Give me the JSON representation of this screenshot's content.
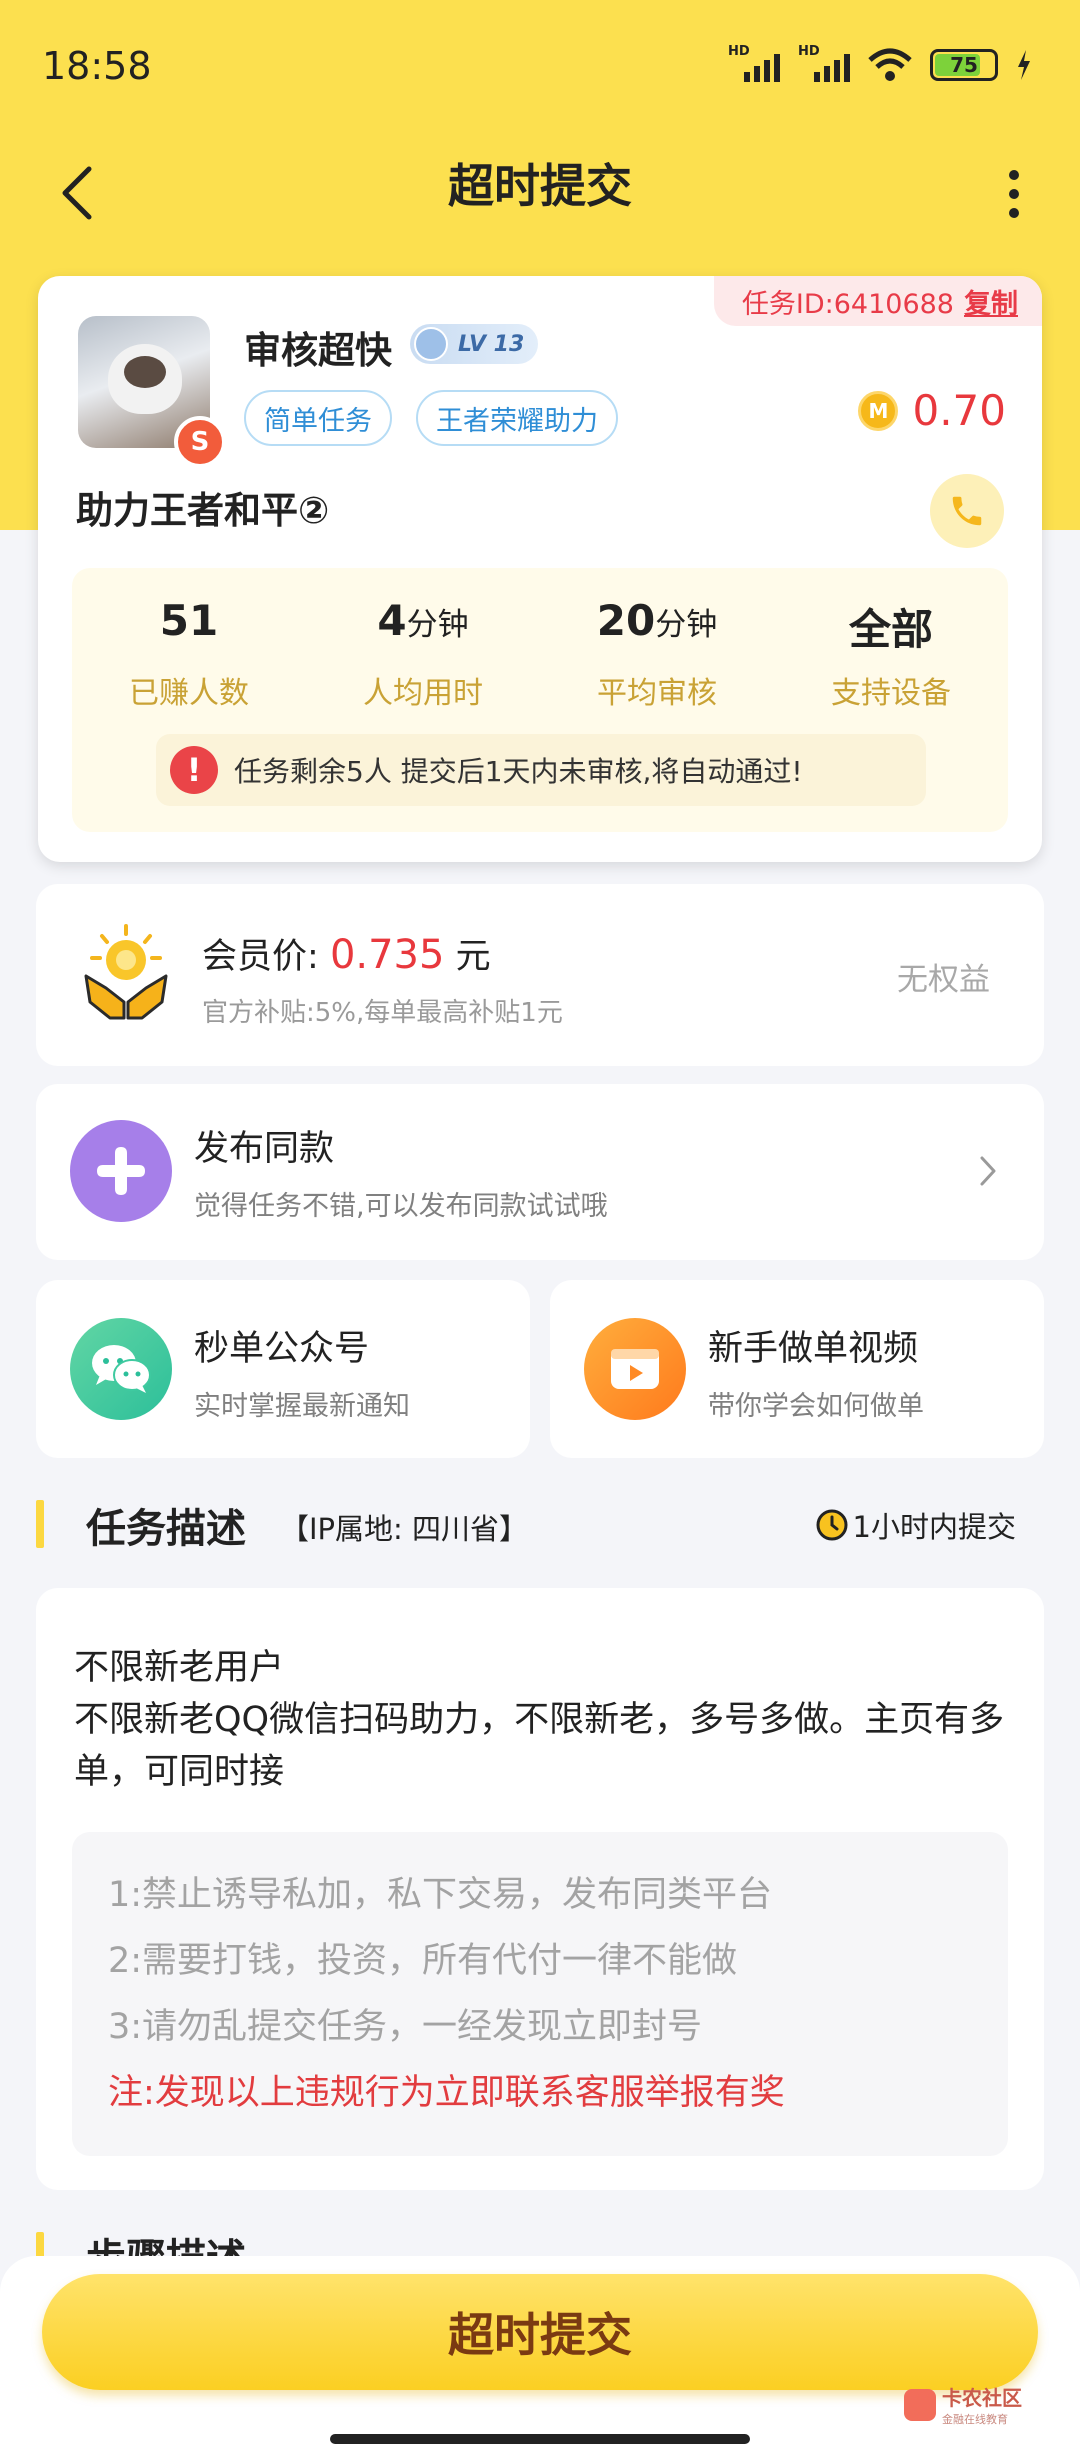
{
  "status_bar": {
    "time": "18:58",
    "signal1_label": "HD",
    "signal2_label": "HD",
    "battery": "75"
  },
  "header": {
    "title": "超时提交"
  },
  "task": {
    "id_label": "任务ID:6410688",
    "copy_label": "复制",
    "avatar_badge": "S",
    "username": "审核超快",
    "level": "LV 13",
    "tags": [
      "简单任务",
      "王者荣耀助力"
    ],
    "coin_letter": "M",
    "price": "0.70",
    "name": "助力王者和平②",
    "stats": [
      {
        "value": "51",
        "unit": "",
        "label": "已赚人数"
      },
      {
        "value": "4",
        "unit": "分钟",
        "label": "人均用时"
      },
      {
        "value": "20",
        "unit": "分钟",
        "label": "平均审核"
      },
      {
        "value": "全部",
        "unit": "",
        "label": "支持设备"
      }
    ],
    "notice_icon": "!",
    "notice": "任务剩余5人  提交后1天内未审核,将自动通过!"
  },
  "member": {
    "label": "会员价:",
    "price": "0.735",
    "unit": "元",
    "sub": "官方补贴:5%,每单最高补贴1元",
    "status": "无权益"
  },
  "publish": {
    "title": "发布同款",
    "sub": "觉得任务不错,可以发布同款试试哦"
  },
  "wechat": {
    "title": "秒单公众号",
    "sub": "实时掌握最新通知"
  },
  "video": {
    "title": "新手做单视频",
    "sub": "带你学会如何做单"
  },
  "description": {
    "title": "任务描述",
    "ip": "【IP属地: 四川省】",
    "deadline": "1小时内提交",
    "lines": [
      "不限新老用户",
      "不限新老QQ微信扫码助力，不限新老，多号多做。主页有多单，可同时接"
    ],
    "rules": [
      "1:禁止诱导私加，私下交易，发布同类平台",
      "2:需要打钱，投资，所有代付一律不能做",
      "3:请勿乱提交任务，一经发现立即封号"
    ],
    "warning": "注:发现以上违规行为立即联系客服举报有奖"
  },
  "steps": {
    "title": "步骤描述"
  },
  "bottom": {
    "submit": "超时提交",
    "watermark": "卡农社区",
    "watermark_sub": "金融在线教育"
  },
  "colors": {
    "brand_yellow": "#fce04f",
    "price_red": "#e8383d",
    "tag_blue": "#2f8ed6",
    "stat_gold": "#c9a235"
  }
}
